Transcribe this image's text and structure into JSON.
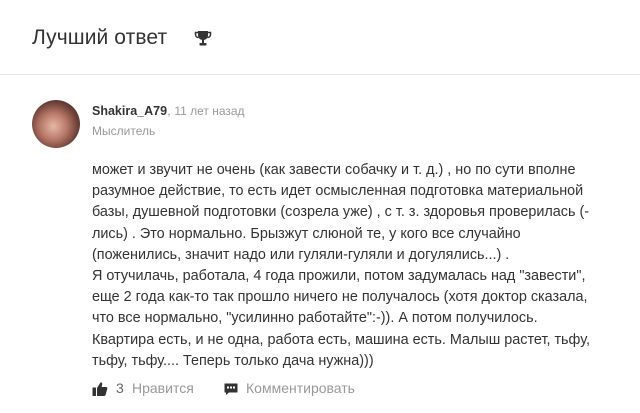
{
  "header": {
    "title": "Лучший ответ",
    "icon": "trophy-icon"
  },
  "answer": {
    "author": {
      "name": "Shakira_A79",
      "separator": ",",
      "time": "11 лет назад",
      "rank": "Мыслитель"
    },
    "lines": [
      "может и звучит не очень (как завести собачку и т. д.) , но по сути вполне",
      "разумное действие, то есть идет осмысленная подготовка материальной",
      "базы, душевной подготовки (созрела уже) , с т. з. здоровья проверилась (-",
      "лись) . Это нормально. Брызжут слюной те, у кого все случайно",
      "(поженились, значит надо или гуляли-гуляли и догулялись...) .",
      "Я отучилачь, работала, 4 года прожили, потом задумалась над \"завести\",",
      "еще 2 года как-то так прошло ничего не получалось (хотя доктор сказала,",
      "что все нормально, \"усилинно работайте\":-)). А потом получилось.",
      "Квартира есть, и не одна, работа есть, машина есть. Малыш растет, тьфу,",
      "тьфу, тьфу.... Теперь только дача нужна)))"
    ],
    "actions": {
      "like_count": "3",
      "like_label": "Нравится",
      "comment_label": "Комментировать"
    }
  },
  "colors": {
    "text": "#333333",
    "muted": "#999999",
    "icon": "#333333",
    "divider": "#e6e6e6"
  }
}
